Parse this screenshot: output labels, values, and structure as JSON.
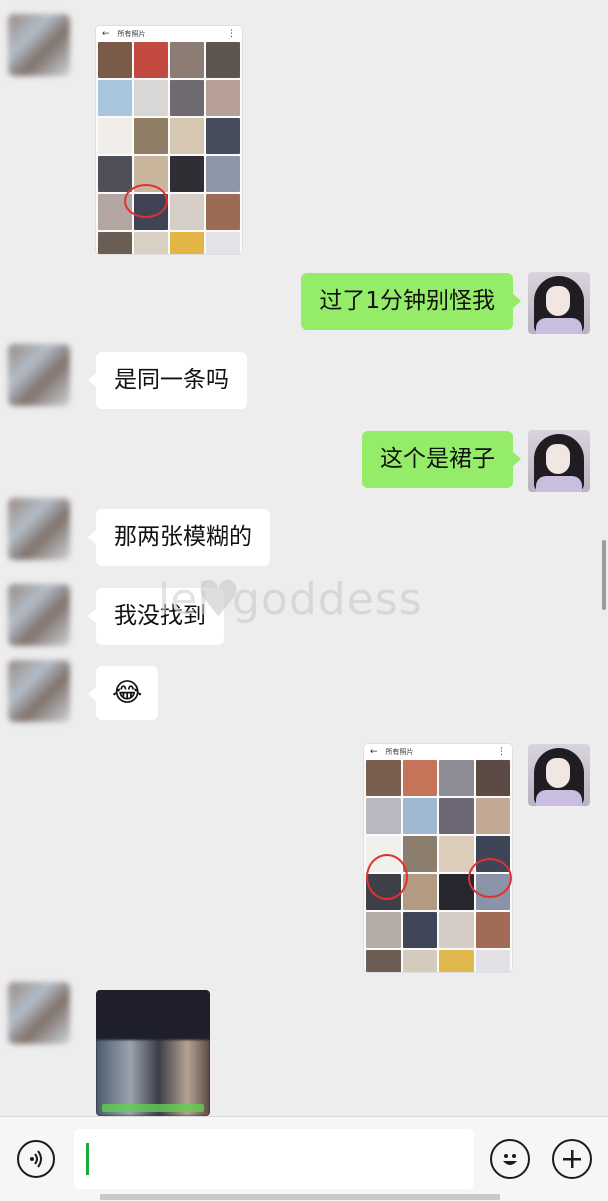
{
  "messages": [
    {
      "side": "right",
      "text": "过了1分钟别怪我"
    },
    {
      "side": "left",
      "text": "是同一条吗"
    },
    {
      "side": "right",
      "text": "这个是裙子"
    },
    {
      "side": "left",
      "text": "那两张模糊的"
    },
    {
      "side": "left",
      "text": "我没找到"
    },
    {
      "side": "left",
      "emoji": "😂"
    }
  ],
  "screenshots": [
    {
      "header_title": "所有照片"
    },
    {
      "header_title": "所有照片"
    }
  ],
  "watermark": {
    "brand": "goddess",
    "prefix": "lei"
  },
  "composer": {
    "input_value": ""
  },
  "colors": {
    "bubble_out": "#95ec69",
    "bubble_in": "#ffffff",
    "background": "#ededed",
    "cursor": "#19ac3d"
  },
  "icons": {
    "voice": "voice-icon",
    "emoji": "emoji-icon",
    "plus": "plus-icon",
    "back": "back-arrow-icon",
    "more": "more-icon"
  }
}
